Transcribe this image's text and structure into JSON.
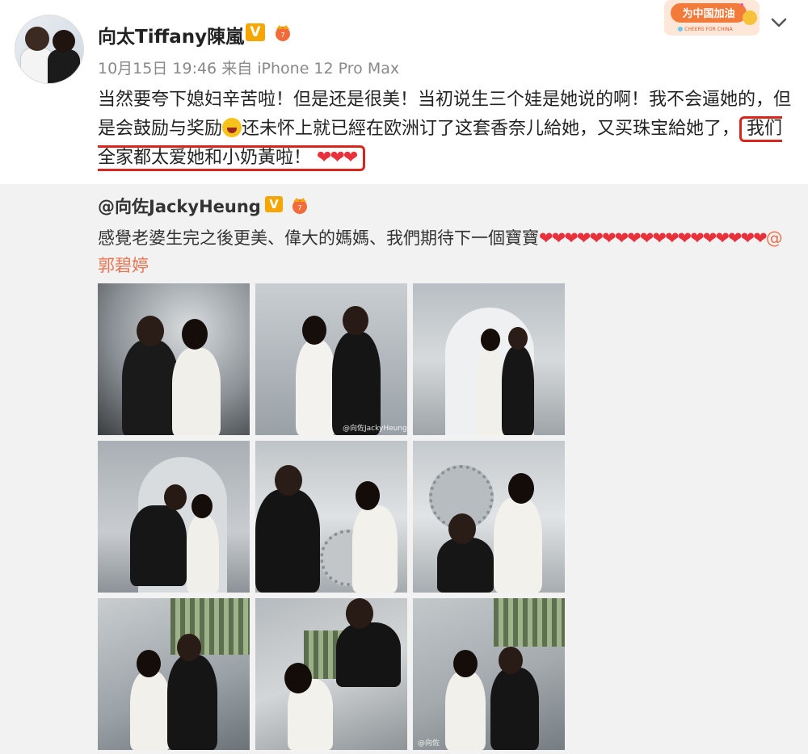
{
  "post": {
    "username": "向太Tiffany陳嵐",
    "verified_badge": "V",
    "timestamp": "10月15日 19:46",
    "source": "来自 iPhone 12 Pro Max",
    "text_part1": "当然要夸下媳妇辛苦啦！但是还是很美！当初说生三个娃是她说的啊！我不会逼她的，但是会鼓励与奖励",
    "text_part2": "还未怀上就已經在欧洲订了这套香奈儿給她，又买珠宝給她了，",
    "highlight_text": "我们全家都太爱她和小奶黃啦！",
    "highlight_hearts": "❤❤❤",
    "highlight_color": "#d9261c",
    "promo_text": "为中国加油",
    "promo_subtext": "CHEERS FOR CHINA"
  },
  "repost": {
    "username": "@向佐JackyHeung",
    "verified_badge": "V",
    "text": "感覺老婆生完之後更美、偉大的媽媽、我們期待下一個寶寶",
    "hearts": "❤❤❤❤❤❤❤❤❤❤❤❤❤❤❤❤❤❤",
    "mention": "@郭碧婷",
    "mention_color": "#eb7350",
    "photos": [
      {
        "name": "photo-1",
        "watermark": ""
      },
      {
        "name": "photo-2",
        "watermark": "@向佐JackyHeung"
      },
      {
        "name": "photo-3",
        "watermark": ""
      },
      {
        "name": "photo-4",
        "watermark": ""
      },
      {
        "name": "photo-5",
        "watermark": ""
      },
      {
        "name": "photo-6",
        "watermark": ""
      },
      {
        "name": "photo-7",
        "watermark": ""
      },
      {
        "name": "photo-8",
        "watermark": ""
      },
      {
        "name": "photo-9",
        "watermark": "@向佐"
      }
    ]
  },
  "colors": {
    "badge_orange": "#f7a600",
    "heart_red": "#e8313a",
    "repost_bg": "#f2f2f2"
  }
}
